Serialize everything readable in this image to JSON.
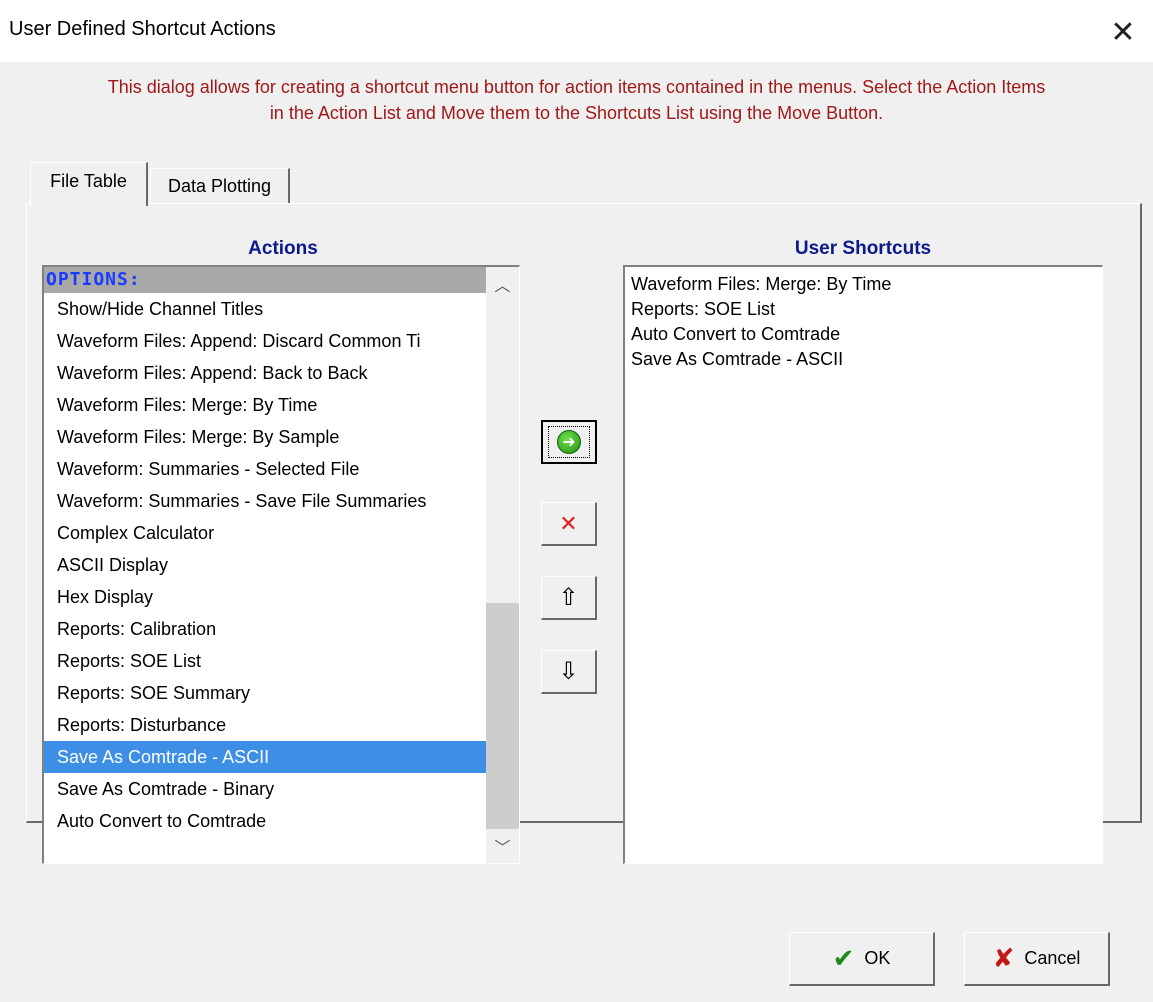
{
  "window": {
    "title": "User Defined Shortcut Actions",
    "close_icon": "close-icon"
  },
  "description": {
    "line1": "This dialog allows for creating a shortcut menu button for action items contained in the menus. Select the Action Items",
    "line2": "in the Action List and Move them to the Shortcuts List using the Move Button."
  },
  "tabs": [
    {
      "label": "File Table",
      "active": true
    },
    {
      "label": "Data Plotting",
      "active": false
    }
  ],
  "actions": {
    "heading": "Actions",
    "header_item": "OPTIONS:",
    "items": [
      "Show/Hide Channel Titles",
      "Waveform Files: Append: Discard Common Ti",
      "Waveform Files: Append: Back to Back",
      "Waveform Files: Merge: By Time",
      "Waveform Files: Merge: By Sample",
      "Waveform: Summaries - Selected File",
      "Waveform: Summaries - Save File Summaries",
      "Complex Calculator",
      "ASCII Display",
      "Hex Display",
      "Reports: Calibration",
      "Reports: SOE List",
      "Reports: SOE Summary",
      "Reports: Disturbance",
      "Save As Comtrade - ASCII",
      "Save As Comtrade - Binary",
      "Auto Convert to Comtrade"
    ],
    "selected_index": 14,
    "scroll_up_icon": "chevron-up-icon",
    "scroll_down_icon": "chevron-down-icon"
  },
  "shortcuts": {
    "heading": "User Shortcuts",
    "items": [
      "Waveform Files: Merge: By Time",
      "Reports: SOE List",
      "Auto Convert to Comtrade",
      "Save As Comtrade - ASCII"
    ]
  },
  "side_buttons": {
    "move_icon": "move-right-icon",
    "delete_icon": "delete-x-icon",
    "up_icon": "arrow-up-icon",
    "down_icon": "arrow-down-icon"
  },
  "footer": {
    "ok_label": "OK",
    "cancel_label": "Cancel"
  },
  "colors": {
    "description": "#a01818",
    "heading": "#0a1a8a",
    "selection": "#3d8fe5"
  }
}
